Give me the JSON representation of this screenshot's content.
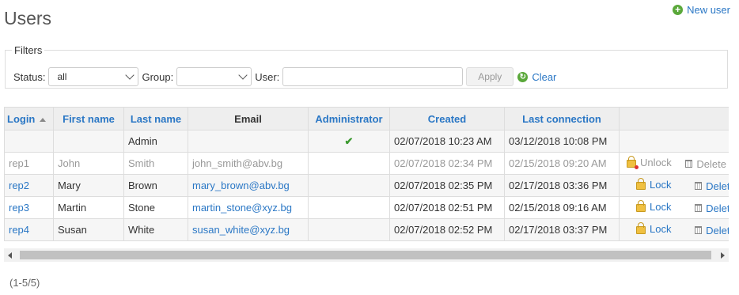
{
  "page": {
    "title": "Users",
    "new_user_label": "New user"
  },
  "filters": {
    "legend": "Filters",
    "status_label": "Status:",
    "status_value": "all",
    "group_label": "Group:",
    "group_value": "",
    "user_label": "User:",
    "user_value": "",
    "apply_label": "Apply",
    "clear_label": "Clear"
  },
  "table": {
    "columns": [
      "Login",
      "First name",
      "Last name",
      "Email",
      "Administrator",
      "Created",
      "Last connection"
    ],
    "sort": {
      "column": "Login",
      "direction": "asc"
    },
    "rows": [
      {
        "login": "",
        "first_name": "",
        "last_name": "Admin",
        "email": "",
        "admin": true,
        "created": "02/07/2018 10:23 AM",
        "last_connection": "03/12/2018 10:08 PM",
        "locked": false,
        "lock_action": "",
        "delete_action": ""
      },
      {
        "login": "rep1",
        "first_name": "John",
        "last_name": "Smith",
        "email": "john_smith@abv.bg",
        "admin": false,
        "created": "02/07/2018 02:34 PM",
        "last_connection": "02/15/2018 09:20 AM",
        "locked": true,
        "lock_action": "Unlock",
        "delete_action": "Delete"
      },
      {
        "login": "rep2",
        "first_name": "Mary",
        "last_name": "Brown",
        "email": "mary_brown@abv.bg",
        "admin": false,
        "created": "02/07/2018 02:35 PM",
        "last_connection": "02/17/2018 03:36 PM",
        "locked": false,
        "lock_action": "Lock",
        "delete_action": "Delete"
      },
      {
        "login": "rep3",
        "first_name": "Martin",
        "last_name": "Stone",
        "email": "martin_stone@xyz.bg",
        "admin": false,
        "created": "02/07/2018 02:51 PM",
        "last_connection": "02/15/2018 09:16 AM",
        "locked": false,
        "lock_action": "Lock",
        "delete_action": "Delete"
      },
      {
        "login": "rep4",
        "first_name": "Susan",
        "last_name": "White",
        "email": "susan_white@xyz.bg",
        "admin": false,
        "created": "02/07/2018 02:52 PM",
        "last_connection": "02/17/2018 03:37 PM",
        "locked": false,
        "lock_action": "Lock",
        "delete_action": "Delete"
      }
    ]
  },
  "pagination": {
    "text": "(1-5/5)"
  },
  "colors": {
    "link": "#2a77c5",
    "header_bg": "#eeeeee",
    "check": "#3c9a30",
    "add_icon": "#5aa83a"
  },
  "icons": {
    "new_user": "add-circle-icon",
    "clear": "reload-icon",
    "admin": "checkmark-icon",
    "lock": "lock-icon",
    "unlock": "unlock-icon",
    "delete": "trash-icon",
    "sort": "sort-asc-icon"
  }
}
